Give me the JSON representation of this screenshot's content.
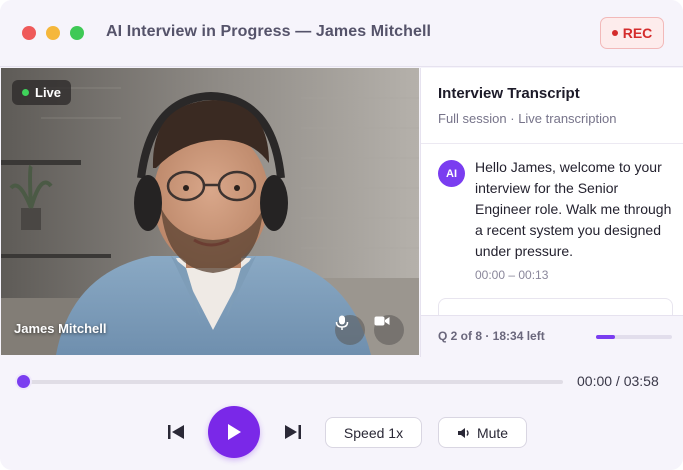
{
  "window": {
    "title": "AI Interview in Progress — James Mitchell",
    "rec_label": "REC"
  },
  "video": {
    "live_label": "Live",
    "participant_name": "James Mitchell",
    "mic_icon": "microphone-icon",
    "camera_icon": "video-camera-icon"
  },
  "transcript": {
    "title": "Interview Transcript",
    "subtitle": "Full session · Live transcription",
    "messages": [
      {
        "speaker": "AI",
        "text": "Hello James, welcome to your interview for the Senior Engineer role. Walk me through a recent system you designed under pressure.",
        "time": "00:00 – 00:13"
      }
    ],
    "question_status": "Q 2 of 8 · 18:34 left",
    "question_progress": 0.25
  },
  "player": {
    "time": "00:00 / 03:58",
    "position": 0.0,
    "speed_label": "Speed 1x",
    "mute_label": "Mute"
  },
  "colors": {
    "accent": "#7a28e8",
    "rec_red": "#d42c2c",
    "live_green": "#3fd35b"
  }
}
